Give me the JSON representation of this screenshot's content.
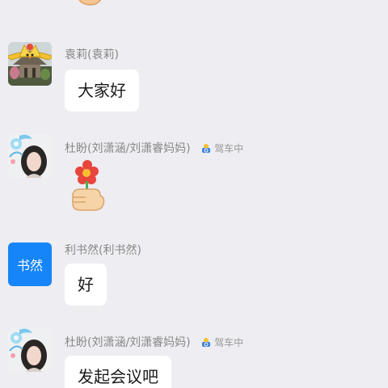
{
  "messages": [
    {
      "sender": "袁莉(袁莉)",
      "text": "大家好"
    },
    {
      "sender": "杜盼(刘潇涵/刘潇睿妈妈)",
      "status": "驾车中"
    },
    {
      "sender": "利书然(利书然)",
      "avatar_text": "书然",
      "text": "好"
    },
    {
      "sender": "杜盼(刘潇涵/刘潇睿妈妈)",
      "status": "驾车中",
      "text": "发起会议吧"
    }
  ],
  "colors": {
    "background": "#ededf2",
    "bubble": "#ffffff",
    "avatar_blue": "#1685f8",
    "sender_text": "#888888"
  }
}
